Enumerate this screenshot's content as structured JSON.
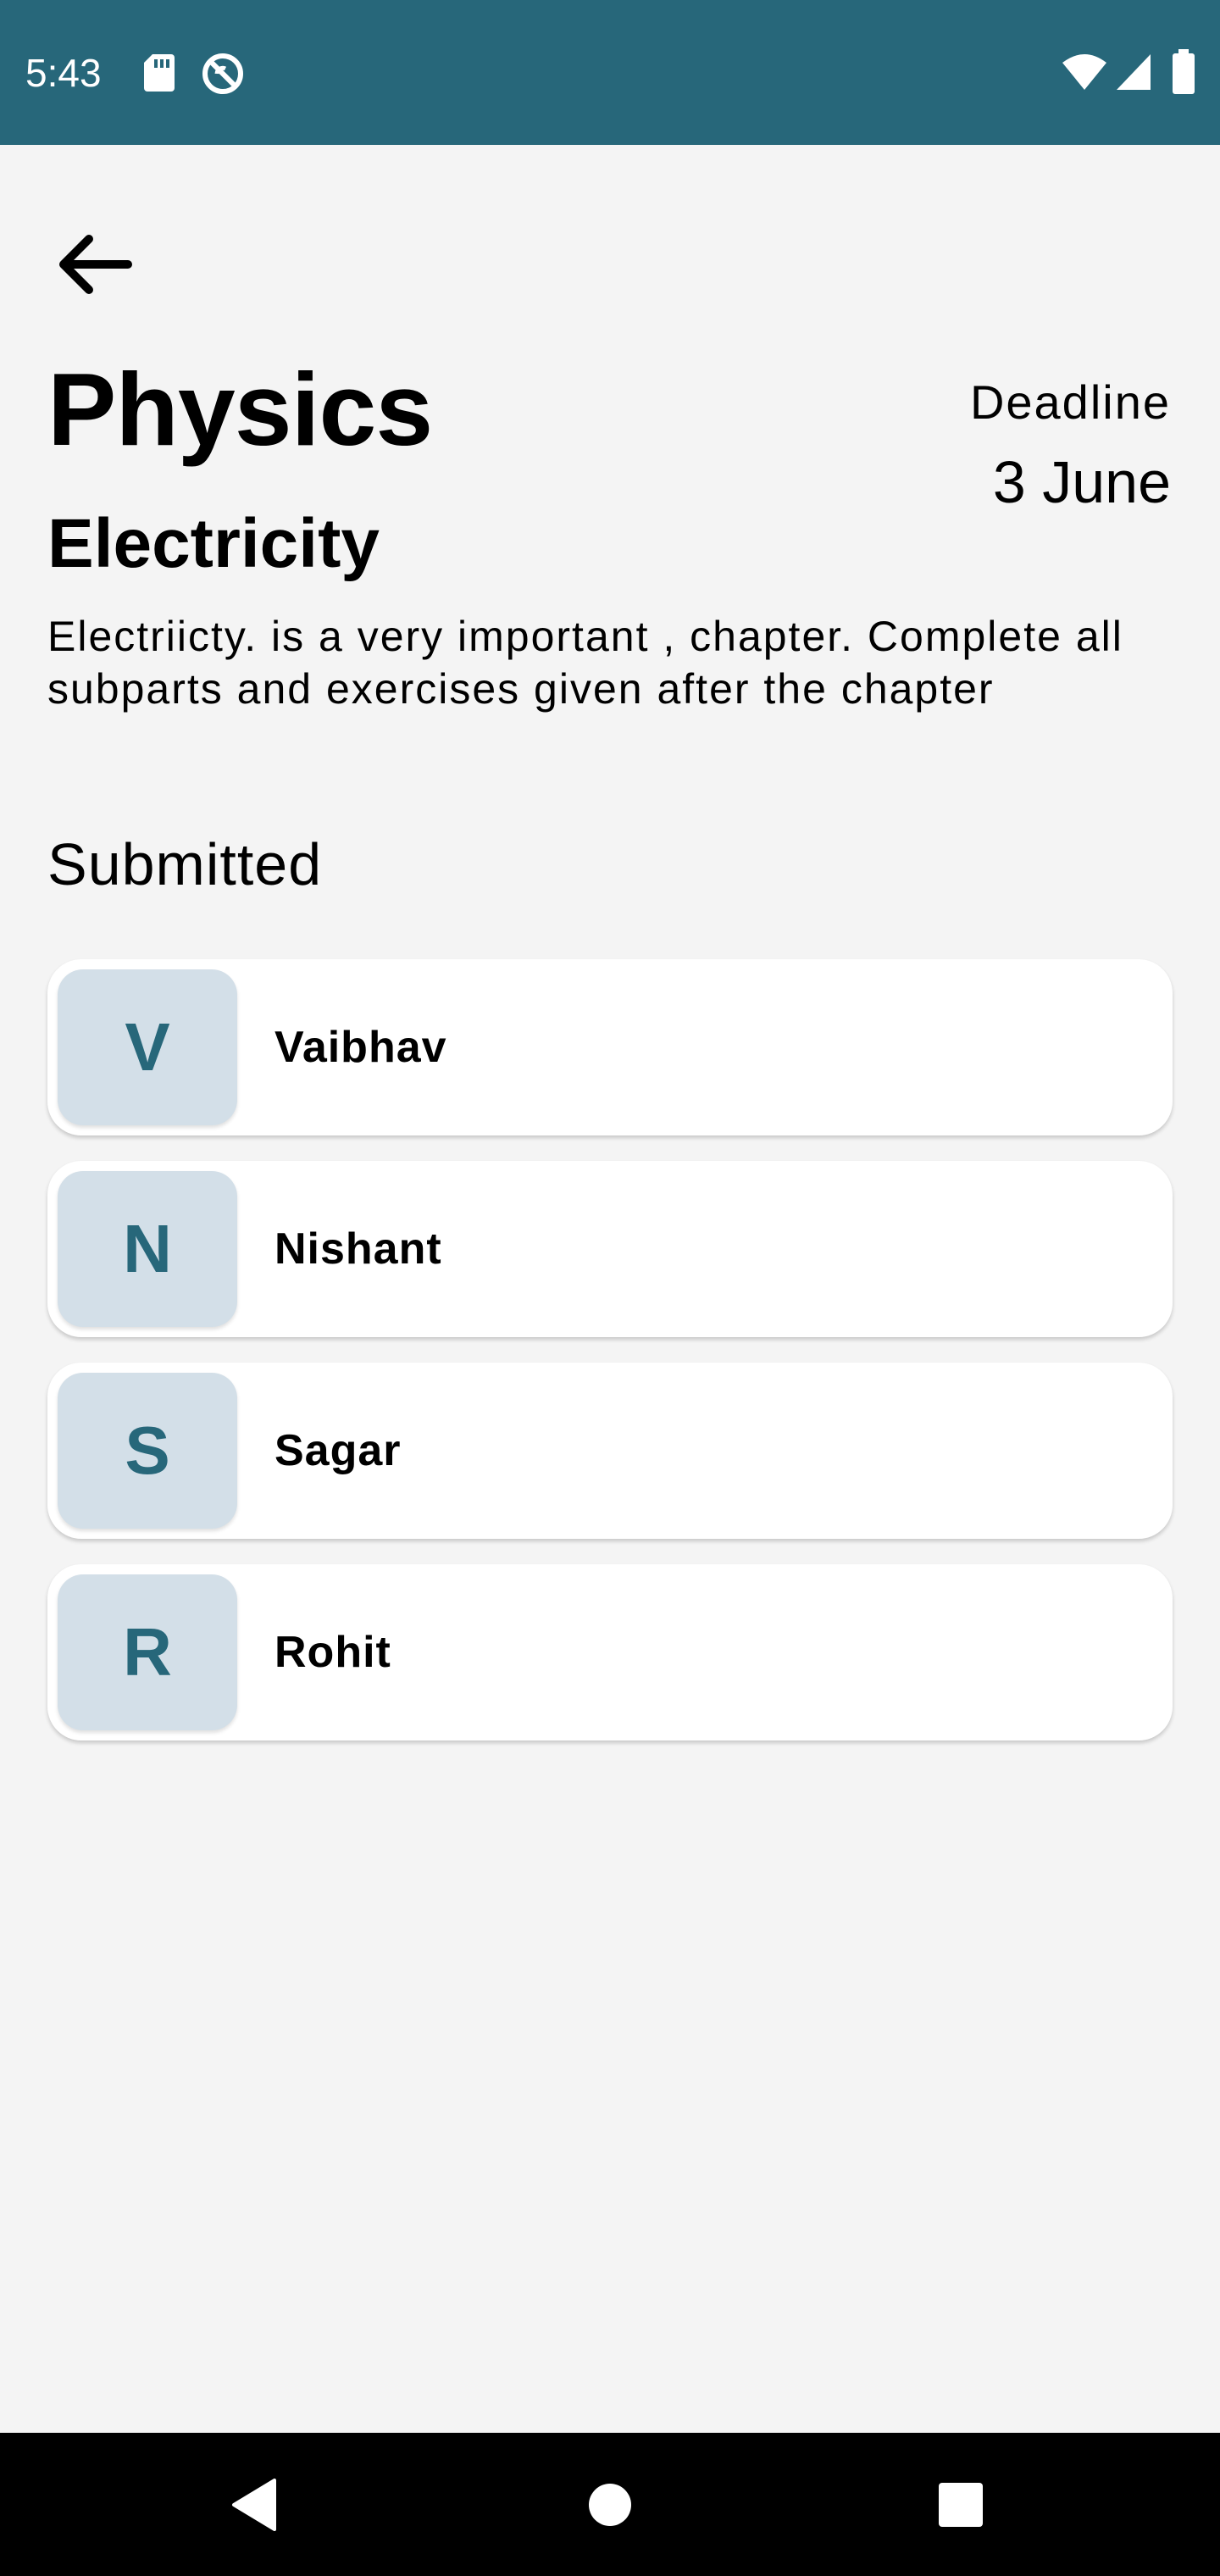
{
  "status_bar": {
    "time": "5:43",
    "left_icons": [
      "sd-card-icon",
      "sync-disabled-icon"
    ],
    "right_icons": [
      "wifi-icon",
      "cellular-signal-icon",
      "battery-icon"
    ],
    "background_color": "#27677a"
  },
  "header": {
    "back_icon": "arrow-back-icon"
  },
  "assignment": {
    "subject": "Physics",
    "deadline_label": "Deadline",
    "deadline_date": "3 June",
    "chapter": "Electricity",
    "description": "Electriicty. is a very important , chapter. Complete all subparts and exercises given after the chapter"
  },
  "submitted": {
    "title": "Submitted",
    "students": [
      {
        "initial": "V",
        "name": "Vaibhav"
      },
      {
        "initial": "N",
        "name": "Nishant"
      },
      {
        "initial": "S",
        "name": "Sagar"
      },
      {
        "initial": "R",
        "name": "Rohit"
      }
    ],
    "avatar_bg_color": "#d3dfe8",
    "avatar_text_color": "#27677a"
  },
  "nav_bar": {
    "icons": [
      "nav-back-icon",
      "nav-home-icon",
      "nav-recents-icon"
    ]
  }
}
